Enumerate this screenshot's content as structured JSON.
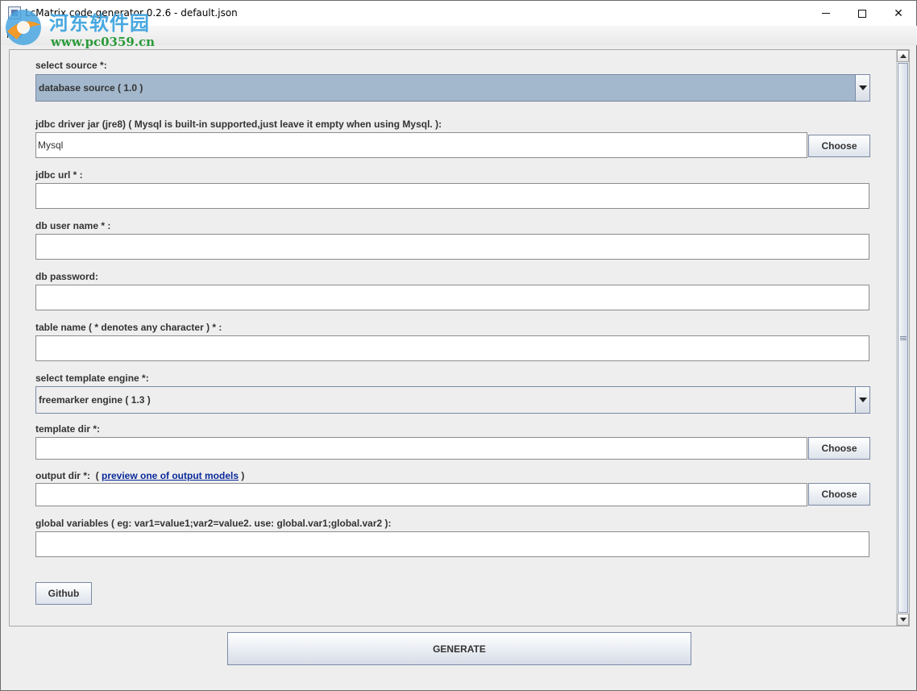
{
  "window": {
    "title": "LcMatrix code generator 0.2.6 - default.json",
    "minimize_icon": "minimize-icon",
    "maximize_icon": "maximize-icon",
    "close_glyph": "✕"
  },
  "watermark": {
    "logo_icon": "watermark-logo-icon",
    "site_name": "河东软件园",
    "url": "www.pc0359.cn"
  },
  "menu": {
    "file_label": "File"
  },
  "form": {
    "source_label": "select source *:",
    "source_value": "database source ( 1.0 )",
    "jdbc_driver_label": "jdbc driver jar (jre8) ( Mysql is built-in supported,just leave it empty when using Mysql. ):",
    "jdbc_driver_value": "Mysql",
    "choose_label": "Choose",
    "jdbc_url_label": "jdbc url * :",
    "jdbc_url_value": "",
    "db_user_label": "db user name * :",
    "db_user_value": "",
    "db_password_label": "db password:",
    "db_password_value": "",
    "table_name_label": "table name ( * denotes any character ) * :",
    "table_name_value": "",
    "template_engine_label": "select template engine *:",
    "template_engine_value": "freemarker engine ( 1.3 )",
    "template_dir_label": "template dir *:",
    "template_dir_value": "",
    "output_dir_label": "output dir *:",
    "output_dir_paren_open": "(",
    "output_dir_link": "preview one of output models",
    "output_dir_paren_close": ")",
    "output_dir_value": "",
    "global_vars_label": "global variables ( eg: var1=value1;var2=value2. use: global.var1;global.var2 ):",
    "global_vars_value": "",
    "github_label": "Github"
  },
  "footer": {
    "generate_label": "GENERATE"
  },
  "colors": {
    "selected_combo_bg": "#a3b8cc",
    "link": "#0a2a9a"
  }
}
